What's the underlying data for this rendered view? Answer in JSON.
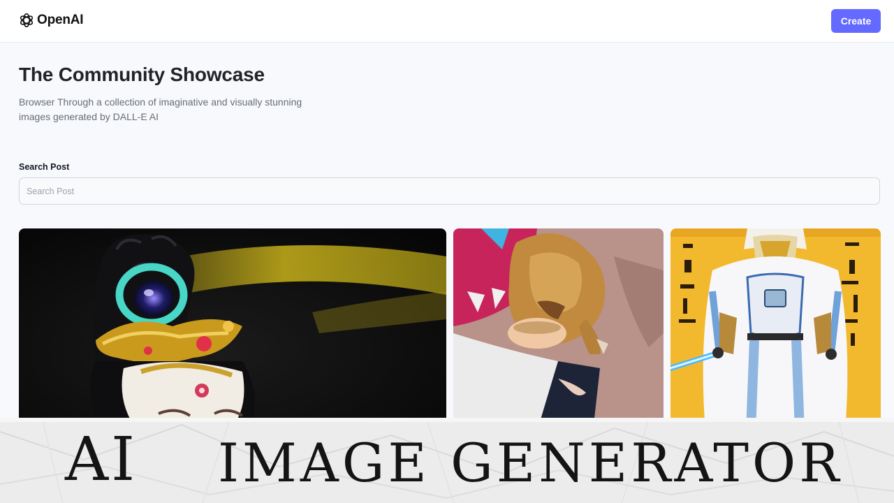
{
  "header": {
    "logo_icon": "openai-logo-icon",
    "logo_text": "OpenAI",
    "create_label": "Create",
    "accent_color": "#6469ff"
  },
  "main": {
    "title": "The Community Showcase",
    "subtitle": "Browser Through a collection of imaginative and visually stunning images generated by DALL-E AI",
    "search": {
      "label": "Search Post",
      "placeholder": "Search Post",
      "value": ""
    }
  },
  "gallery": {
    "images": [
      {
        "subject": "ornate-goddess-figure-image"
      },
      {
        "subject": "lion-eating-image"
      },
      {
        "subject": "space-trooper-poster-image"
      }
    ]
  },
  "banner": {
    "word_1": "AI",
    "word_2": "IMAGE GENERATOR"
  }
}
